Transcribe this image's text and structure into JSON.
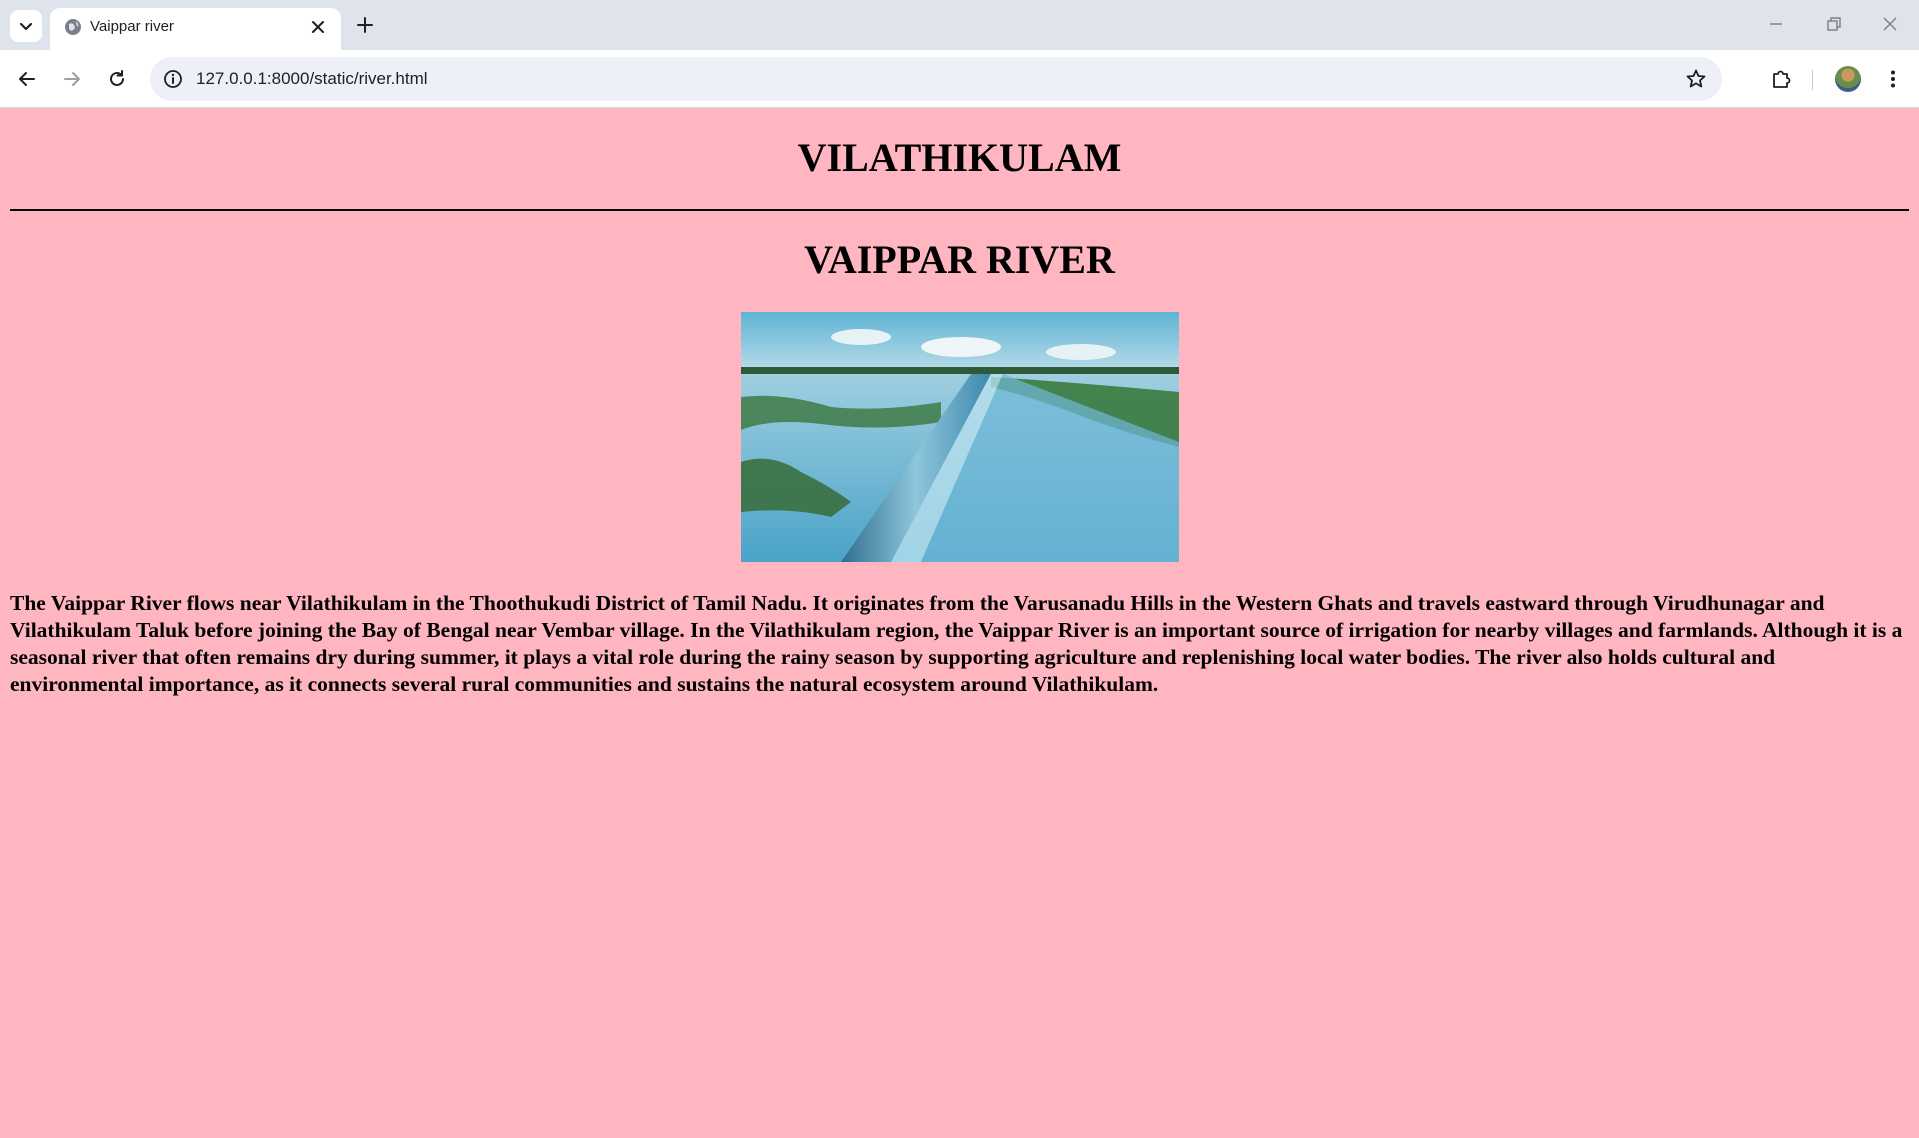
{
  "browser": {
    "tab_title": "Vaippar river",
    "url": "127.0.0.1:8000/static/river.html",
    "icons": {
      "tab_list": "chevron-down-icon",
      "favicon": "globe-icon",
      "tab_close": "close-icon",
      "new_tab": "plus-icon",
      "back": "arrow-left-icon",
      "forward": "arrow-right-icon",
      "reload": "reload-icon",
      "site_info": "info-icon",
      "bookmark": "star-icon",
      "extensions": "puzzle-icon",
      "profile": "avatar",
      "menu": "kebab-menu-icon",
      "minimize": "minimize-icon",
      "restore": "restore-icon",
      "close_window": "close-icon"
    }
  },
  "page": {
    "background": "#ffb6c1",
    "heading": "VILATHIKULAM",
    "subheading": "VAIPPAR RIVER",
    "image_description": "river-check-dam-photo",
    "paragraph": "The Vaippar River flows near Vilathikulam in the Thoothukudi District of Tamil Nadu. It originates from the Varusanadu Hills in the Western Ghats and travels eastward through Virudhunagar and Vilathikulam Taluk before joining the Bay of Bengal near Vembar village. In the Vilathikulam region, the Vaippar River is an important source of irrigation for nearby villages and farmlands. Although it is a seasonal river that often remains dry during summer, it plays a vital role during the rainy season by supporting agriculture and replenishing local water bodies. The river also holds cultural and environmental importance, as it connects several rural communities and sustains the natural ecosystem around Vilathikulam."
  }
}
